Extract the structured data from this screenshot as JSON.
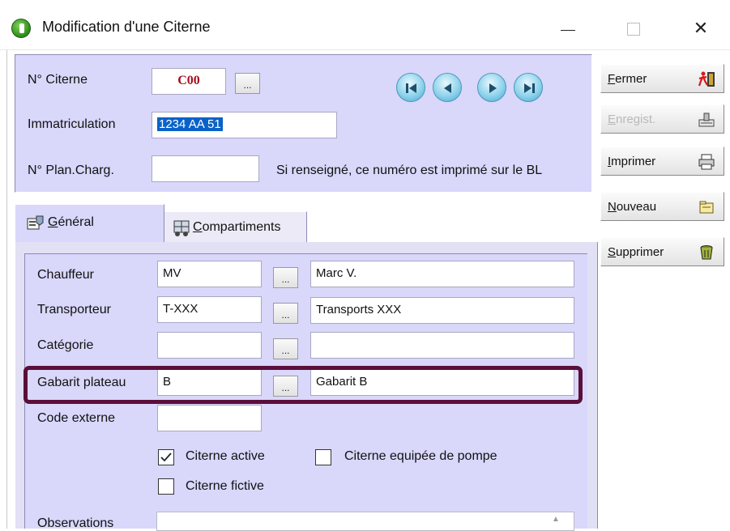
{
  "window": {
    "title": "Modification d'une Citerne",
    "close_glyph": "✕"
  },
  "header": {
    "citerne_label": "N° Citerne",
    "citerne_value": "C00",
    "immat_label": "Immatriculation",
    "immat_value": "1234 AA 51",
    "plan_label": "N° Plan.Charg.",
    "plan_value": "",
    "plan_hint": "Si renseigné, ce numéro est imprimé sur le BL",
    "lookup_label": "...",
    "nav_icons": [
      "first-record-icon",
      "previous-record-icon",
      "next-record-icon",
      "last-record-icon"
    ]
  },
  "tabs": [
    {
      "accel": "G",
      "rest": "énéral",
      "icon": "general-tab-icon",
      "active": true
    },
    {
      "accel": "C",
      "rest": "ompartiments",
      "icon": "compartments-tab-icon",
      "active": false
    }
  ],
  "form": {
    "lookup_label": "...",
    "rows": [
      {
        "label": "Chauffeur",
        "code": "MV",
        "description": "Marc V."
      },
      {
        "label": "Transporteur",
        "code": "T-XXX",
        "description": "Transports XXX"
      },
      {
        "label": "Catégorie",
        "code": "",
        "description": ""
      },
      {
        "label": "Gabarit plateau",
        "code": "B",
        "description": "Gabarit B"
      }
    ],
    "code_externe_label": "Code externe",
    "code_externe_value": "",
    "checkboxes": [
      {
        "label": "Citerne active",
        "checked": true
      },
      {
        "label": "Citerne equipée de pompe",
        "checked": false
      },
      {
        "label": "Citerne fictive",
        "checked": false
      }
    ],
    "observations_label": "Observations",
    "observations_value": "",
    "highlight_color": "#5a0f3a"
  },
  "side_buttons": [
    {
      "accel": "F",
      "rest": "ermer",
      "icon": "exit-door-icon",
      "enabled": true
    },
    {
      "accel": "E",
      "rest": "nregist.",
      "icon": "save-icon",
      "enabled": false
    },
    {
      "accel": "I",
      "rest": "mprimer",
      "icon": "printer-icon",
      "enabled": true
    },
    {
      "accel": "N",
      "rest": "ouveau",
      "icon": "new-document-icon",
      "enabled": true
    },
    {
      "accel": "S",
      "rest": "upprimer",
      "icon": "delete-bin-icon",
      "enabled": true
    }
  ],
  "colors": {
    "panel": "#d9d7fa",
    "code_text": "#a30f1c",
    "selection": "#0a62c8"
  }
}
